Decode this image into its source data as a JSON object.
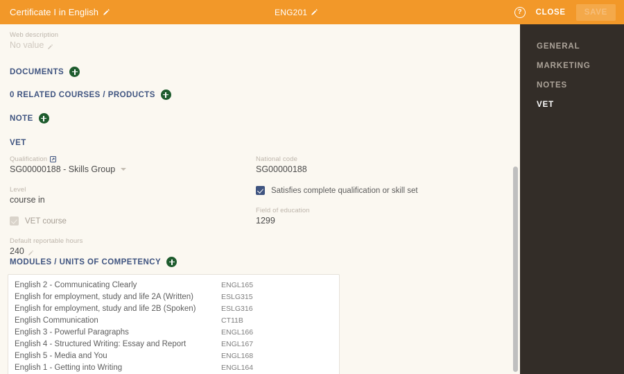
{
  "header": {
    "title": "Certificate I in English",
    "code": "ENG201",
    "help_icon": "help-icon",
    "close_label": "CLOSE",
    "save_label": "SAVE",
    "bg_color": "#F29829"
  },
  "sidebar": {
    "bg_color": "#332D28",
    "items": [
      {
        "label": "GENERAL",
        "active": false
      },
      {
        "label": "MARKETING",
        "active": false
      },
      {
        "label": "NOTES",
        "active": false
      },
      {
        "label": "VET",
        "active": true
      }
    ]
  },
  "web_description": {
    "label": "Web description",
    "value": "No value"
  },
  "sections": {
    "documents": "DOCUMENTS",
    "related": "0 RELATED COURSES / PRODUCTS",
    "note": "NOTE",
    "vet": "VET",
    "modules": "MODULES / UNITS OF COMPETENCY"
  },
  "vet": {
    "qualification": {
      "label": "Qualification",
      "value": "SG00000188 - Skills Group"
    },
    "national_code": {
      "label": "National code",
      "value": "SG00000188"
    },
    "level": {
      "label": "Level",
      "value": "course in"
    },
    "satisfies": {
      "label": "Satisfies complete qualification or skill set",
      "checked": true
    },
    "vet_course": {
      "label": "VET course",
      "checked": true,
      "disabled": true
    },
    "field_of_education": {
      "label": "Field of education",
      "value": "1299"
    },
    "default_reportable_hours": {
      "label": "Default reportable hours",
      "value": "240"
    }
  },
  "modules": [
    {
      "name": "English 2 - Communicating Clearly",
      "code": "ENGL165"
    },
    {
      "name": "English for employment, study and life 2A (Written)",
      "code": "ESLG315"
    },
    {
      "name": "English for employment, study and life 2B (Spoken)",
      "code": "ESLG316"
    },
    {
      "name": "English Communication",
      "code": "CT11B"
    },
    {
      "name": "English 3 - Powerful Paragraphs",
      "code": "ENGL166"
    },
    {
      "name": "English 4 - Structured Writing: Essay and Report",
      "code": "ENGL167"
    },
    {
      "name": "English 5 - Media and You",
      "code": "ENGL168"
    },
    {
      "name": "English 1 - Getting into Writing",
      "code": "ENGL164"
    }
  ],
  "colors": {
    "page_bg": "#FBF8F1",
    "accent": "#F29829",
    "section_heading": "#3F5480",
    "plus_green": "#1E5C2E",
    "sidebar": "#332D28"
  }
}
